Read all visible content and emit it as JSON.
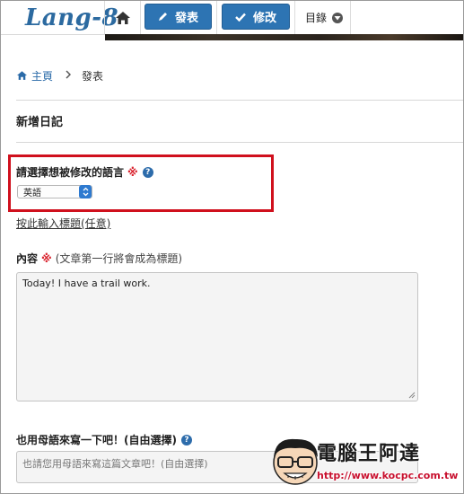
{
  "header": {
    "logo": "Lang-8",
    "post_label": "發表",
    "correct_label": "修改",
    "menu_label": "目錄"
  },
  "breadcrumb": {
    "home": "主頁",
    "current": "發表"
  },
  "page_title": "新增日記",
  "language": {
    "label": "請選擇想被修改的語言",
    "required_mark": "※",
    "selected": "英語"
  },
  "title_link": "按此輸入標題(任意)",
  "content": {
    "label": "內容",
    "required_mark": "※",
    "hint": "(文章第一行將會成為標題)",
    "value": "Today! I have a trail work."
  },
  "native": {
    "label": "也用母語來寫一下吧！(自由選擇)",
    "placeholder": "也請您用母語來寫這篇文章吧！(自由選擇)"
  },
  "watermark": {
    "title": "電腦王阿達",
    "url": "http://www.kocpc.com.tw"
  },
  "colors": {
    "brand_blue": "#2d74b3",
    "highlight_red": "#d0101d",
    "link_blue": "#2a6aa8"
  }
}
